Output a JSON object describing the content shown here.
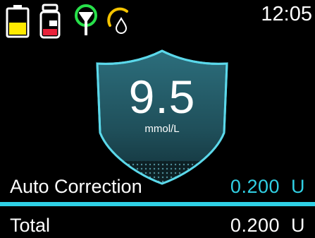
{
  "status_bar": {
    "time": "12:05",
    "icons": [
      "battery-icon",
      "insulin-cartridge-icon",
      "cgm-signal-icon",
      "insulin-drop-icon"
    ],
    "colors": {
      "battery_fill": "#ffea00",
      "cartridge_fill": "#e8223a",
      "signal": "#27e04a",
      "insulin_arc": "#f4c300"
    }
  },
  "glucose": {
    "value": "9.5",
    "unit": "mmol/L",
    "shield_color": "#5bd8ea"
  },
  "rows": {
    "auto_correction": {
      "label": "Auto Correction",
      "value": "0.200  U"
    },
    "total": {
      "label": "Total",
      "value": "0.200  U"
    }
  },
  "colors": {
    "accent": "#2fd1e6",
    "background": "#000000"
  }
}
